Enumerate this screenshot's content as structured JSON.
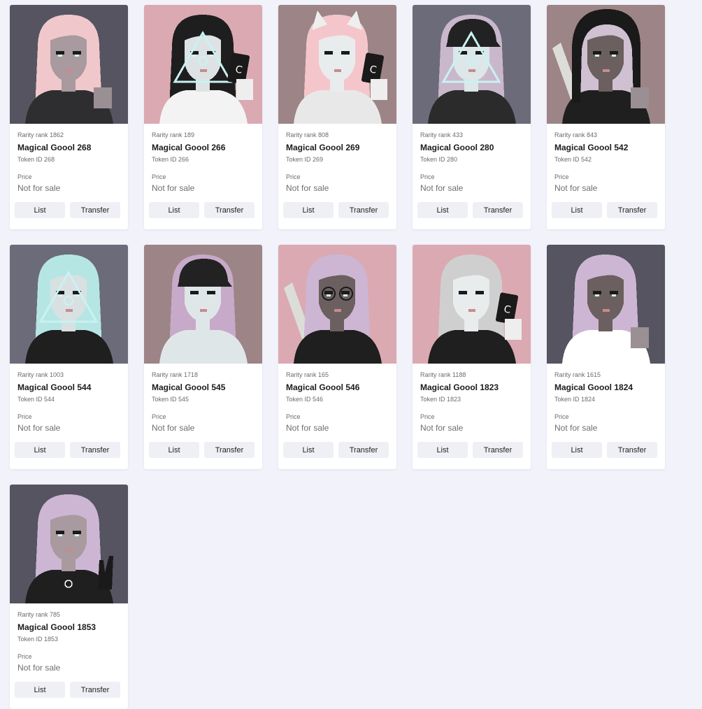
{
  "labels": {
    "price": "Price",
    "list": "List",
    "transfer": "Transfer"
  },
  "cards": [
    {
      "rank": "Rarity rank 1862",
      "name": "Magical Goool 268",
      "token": "Token ID 268",
      "price": "Not for sale",
      "bg": "#555460",
      "hair": "#f0c8cc",
      "skin": "#a89a9e",
      "top": "#2e2e30",
      "accent": "none"
    },
    {
      "rank": "Rarity rank 189",
      "name": "Magical Goool 266",
      "token": "Token ID 266",
      "price": "Not for sale",
      "bg": "#dba9b2",
      "hair": "#1e1e1e",
      "skin": "#dde3e4",
      "top": "#f3f3f3",
      "accent": "triangle-card"
    },
    {
      "rank": "Rarity rank 808",
      "name": "Magical Goool 269",
      "token": "Token ID 269",
      "price": "Not for sale",
      "bg": "#9d8486",
      "hair": "#f4c6cb",
      "skin": "#e9ecec",
      "top": "#e8e8e8",
      "accent": "ears-card"
    },
    {
      "rank": "Rarity rank 433",
      "name": "Magical Goool 280",
      "token": "Token ID 280",
      "price": "Not for sale",
      "bg": "#6c6b7a",
      "hair": "#c9b8cc",
      "skin": "#dde6e8",
      "top": "#2b2b2b",
      "accent": "cap-triangle"
    },
    {
      "rank": "Rarity rank 843",
      "name": "Magical Goool 542",
      "token": "Token ID 542",
      "price": "Not for sale",
      "bg": "#9d8486",
      "hair": "#cfc1d1",
      "skin": "#6b5f5f",
      "top": "#1f1f1f",
      "accent": "bat-hood"
    },
    {
      "rank": "Rarity rank 1003",
      "name": "Magical Goool 544",
      "token": "Token ID 544",
      "price": "Not for sale",
      "bg": "#6c6b7a",
      "hair": "#b6e6e3",
      "skin": "#d9e0e2",
      "top": "#1f1f1f",
      "accent": "triangle"
    },
    {
      "rank": "Rarity rank 1718",
      "name": "Magical Goool 545",
      "token": "Token ID 545",
      "price": "Not for sale",
      "bg": "#9d8486",
      "hair": "#c7a9c9",
      "skin": "#dfe6e8",
      "top": "#dfe6e8",
      "accent": "cap"
    },
    {
      "rank": "Rarity rank 165",
      "name": "Magical Goool 546",
      "token": "Token ID 546",
      "price": "Not for sale",
      "bg": "#dba9b2",
      "hair": "#cdb6d3",
      "skin": "#6b5f5f",
      "top": "#1f1f1f",
      "accent": "bat-glasses"
    },
    {
      "rank": "Rarity rank 1188",
      "name": "Magical Goool 1823",
      "token": "Token ID 1823",
      "price": "Not for sale",
      "bg": "#dba9b2",
      "hair": "#cfcfcf",
      "skin": "#e9ecec",
      "top": "#1f1f1f",
      "accent": "card"
    },
    {
      "rank": "Rarity rank 1615",
      "name": "Magical Goool 1824",
      "token": "Token ID 1824",
      "price": "Not for sale",
      "bg": "#555460",
      "hair": "#cdb6d3",
      "skin": "#6b5f5f",
      "top": "#ffffff",
      "accent": "none"
    },
    {
      "rank": "Rarity rank 785",
      "name": "Magical Goool 1853",
      "token": "Token ID 1853",
      "price": "Not for sale",
      "bg": "#555460",
      "hair": "#cdb6d3",
      "skin": "#a89a9e",
      "top": "#1f1f1f",
      "accent": "horns-hand"
    }
  ]
}
